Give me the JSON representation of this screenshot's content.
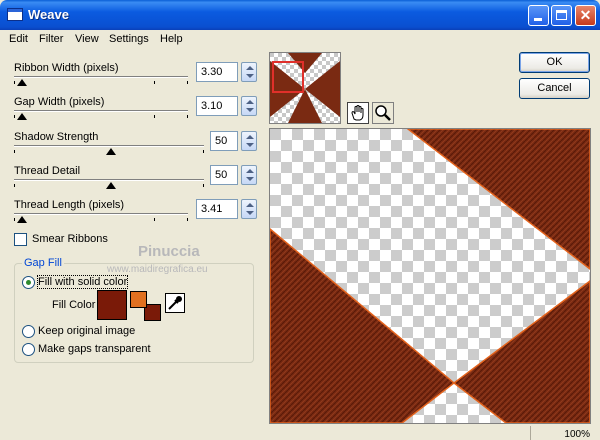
{
  "window": {
    "title": "Weave"
  },
  "titlebar_buttons": {
    "close_glyph": "✕"
  },
  "menu": [
    "Edit",
    "Filter",
    "View",
    "Settings",
    "Help"
  ],
  "controls": {
    "ribbon_width": {
      "label": "Ribbon Width (pixels)",
      "value": "3.30"
    },
    "gap_width": {
      "label": "Gap Width (pixels)",
      "value": "3.10"
    },
    "shadow_strength": {
      "label": "Shadow Strength",
      "value": "50"
    },
    "thread_detail": {
      "label": "Thread Detail",
      "value": "50"
    },
    "thread_length": {
      "label": "Thread Length (pixels)",
      "value": "3.41"
    }
  },
  "smear_ribbons": {
    "label": "Smear Ribbons",
    "checked": false
  },
  "gap_fill": {
    "title": "Gap Fill",
    "options": [
      "Fill with solid color",
      "Keep original image",
      "Make gaps transparent"
    ],
    "selected": "Fill with solid color",
    "fill_color_label": "Fill Color"
  },
  "buttons": {
    "ok": "OK",
    "cancel": "Cancel"
  },
  "watermark": {
    "name": "Pinuccia",
    "url": "www.maidiregrafica.eu"
  },
  "status": {
    "zoom": "100%"
  },
  "icons": {
    "pan": "hand-icon",
    "zoom": "magnifier-icon",
    "dropper": "eyedropper-icon",
    "app": "window-icon"
  },
  "colors": {
    "fill_color": "#7a1a08",
    "foreground": "#e07020",
    "background": "#7a1a08",
    "ribbon": "#7a2a12",
    "ribbon_edge": "#e3631d",
    "titlebar": "#0a5fd6",
    "group_title": "#0046d5"
  }
}
